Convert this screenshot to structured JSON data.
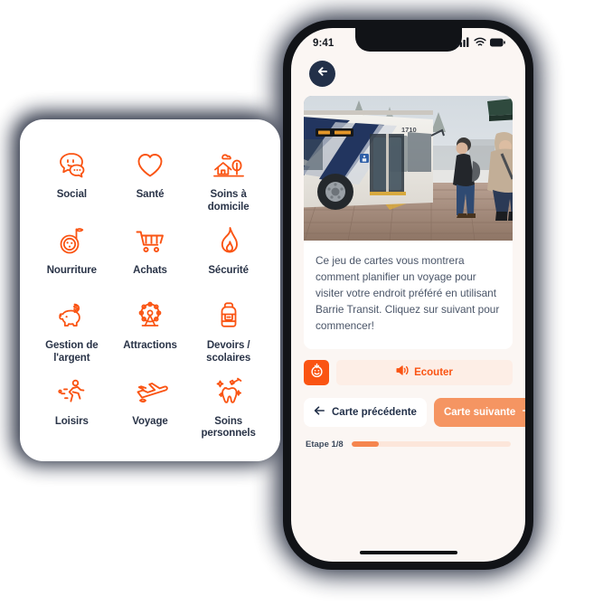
{
  "categories_panel": {
    "items": [
      {
        "label": "Social",
        "icon": "speech-bubbles-icon"
      },
      {
        "label": "Santé",
        "icon": "heart-icon"
      },
      {
        "label": "Soins à domicile",
        "icon": "house-tree-icon"
      },
      {
        "label": "Nourriture",
        "icon": "pizza-icon"
      },
      {
        "label": "Achats",
        "icon": "shopping-cart-icon"
      },
      {
        "label": "Sécurité",
        "icon": "flame-icon"
      },
      {
        "label": "Gestion de l'argent",
        "icon": "piggy-bank-icon"
      },
      {
        "label": "Attractions",
        "icon": "ferris-wheel-icon"
      },
      {
        "label": "Devoirs / scolaires",
        "icon": "backpack-icon"
      },
      {
        "label": "Loisirs",
        "icon": "running-person-icon"
      },
      {
        "label": "Voyage",
        "icon": "airplane-icon"
      },
      {
        "label": "Soins personnels",
        "icon": "tooth-brush-icon"
      }
    ]
  },
  "phone": {
    "status_bar": {
      "time": "9:41",
      "icons": [
        "cellular-signal-icon",
        "wifi-icon",
        "battery-icon"
      ]
    },
    "header": {
      "back_icon": "arrow-left-icon"
    },
    "card": {
      "image_alt": "Autobus de ville blanc et bleu avec portes ouvertes, deux personnes en manteaux d'hiver attendant sur le trottoir",
      "bus_number": "1710",
      "body_text": "Ce jeu de cartes vous montrera comment planifier un voyage pour visiter votre endroit préféré en utilisant Barrie Transit. Cliquez sur suivant pour commencer!"
    },
    "listen_row": {
      "accessibility_icon": "accessibility-face-icon",
      "listen_label": "Ecouter",
      "listen_icon": "speaker-icon"
    },
    "navigation": {
      "previous_label": "Carte précédente",
      "previous_icon": "arrow-left-icon",
      "next_label": "Carte suivante",
      "next_icon": "arrow-right-icon"
    },
    "progress": {
      "step_label": "Etape 1/8",
      "current_step": 1,
      "total_steps": 8,
      "percent": 17
    }
  },
  "colors": {
    "accent_orange": "#fa5413",
    "soft_orange": "#f59562",
    "navy": "#223049",
    "screen_bg": "#fbf6f3",
    "label_navy": "#2a3448"
  }
}
